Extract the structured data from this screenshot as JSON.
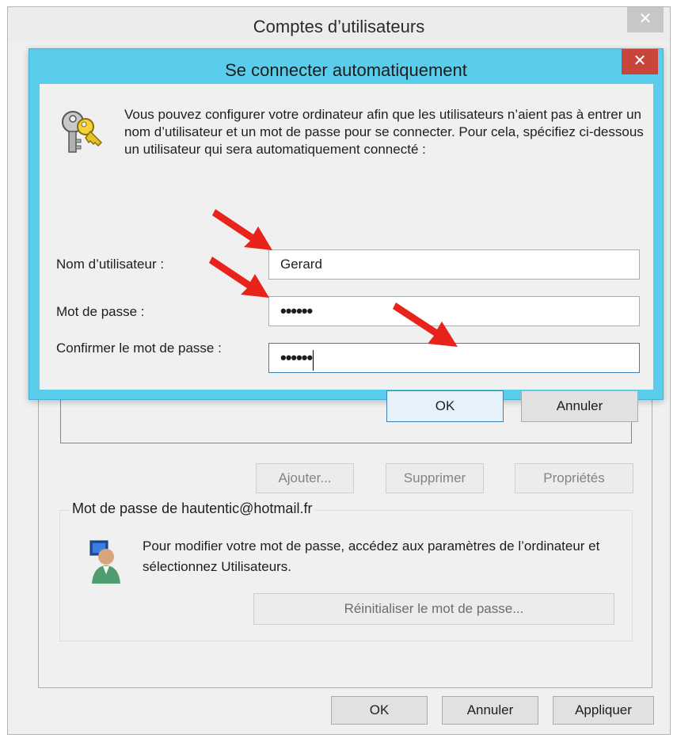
{
  "outer_window": {
    "title": "Comptes d’utilisateurs",
    "close_glyph": "✕",
    "buttons": {
      "add": "Ajouter...",
      "remove": "Supprimer",
      "properties": "Propriétés"
    },
    "password_group": {
      "label": "Mot de passe de hautentic@hotmail.fr",
      "text": "Pour modifier votre mot de passe, accédez aux paramètres de l’ordinateur et sélectionnez Utilisateurs.",
      "reset_button": "Réinitialiser le mot de passe..."
    },
    "footer": {
      "ok": "OK",
      "cancel": "Annuler",
      "apply": "Appliquer"
    }
  },
  "dialog": {
    "title": "Se connecter automatiquement",
    "close_glyph": "✕",
    "intro": "Vous pouvez configurer votre ordinateur afin que les utilisateurs n’aient pas à entrer un nom d’utilisateur et un mot de passe pour se connecter. Pour cela, spécifiez ci-dessous un utilisateur qui sera automatiquement connecté :",
    "username_label": "Nom d’utilisateur :",
    "username_value": "Gerard",
    "password_label": "Mot de passe :",
    "password_value": "••••••",
    "confirm_label": "Confirmer le mot de passe :",
    "confirm_value": "••••••",
    "ok": "OK",
    "cancel": "Annuler"
  },
  "colors": {
    "dialog_frame": "#5bcdec",
    "close_red": "#c7453a",
    "arrow_red": "#e8231b"
  },
  "icons": [
    "keys-icon",
    "user-picture-icon",
    "close-icon",
    "annotation-arrow-icon"
  ]
}
